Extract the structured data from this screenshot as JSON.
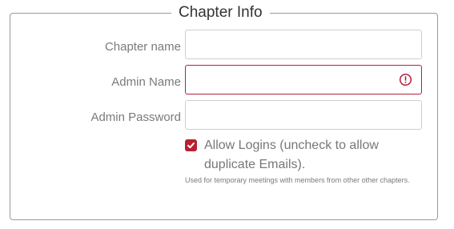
{
  "section": {
    "title": "Chapter Info"
  },
  "fields": [
    {
      "label": "Chapter name",
      "value": "",
      "state": "normal"
    },
    {
      "label": "Admin Name",
      "value": "",
      "state": "invalid"
    },
    {
      "label": "Admin Password",
      "value": "",
      "state": "normal"
    }
  ],
  "allow_logins": {
    "checked": true,
    "label": "Allow Logins (uncheck to allow duplicate Emails).",
    "help": "Used for temporary meetings with members from other other chapters."
  },
  "colors": {
    "accent": "#b81f33",
    "error_border": "#b3213a",
    "label_text": "#7a7a7a"
  },
  "icons": {
    "error": "exclamation-circle-icon",
    "check": "checkmark-icon"
  }
}
